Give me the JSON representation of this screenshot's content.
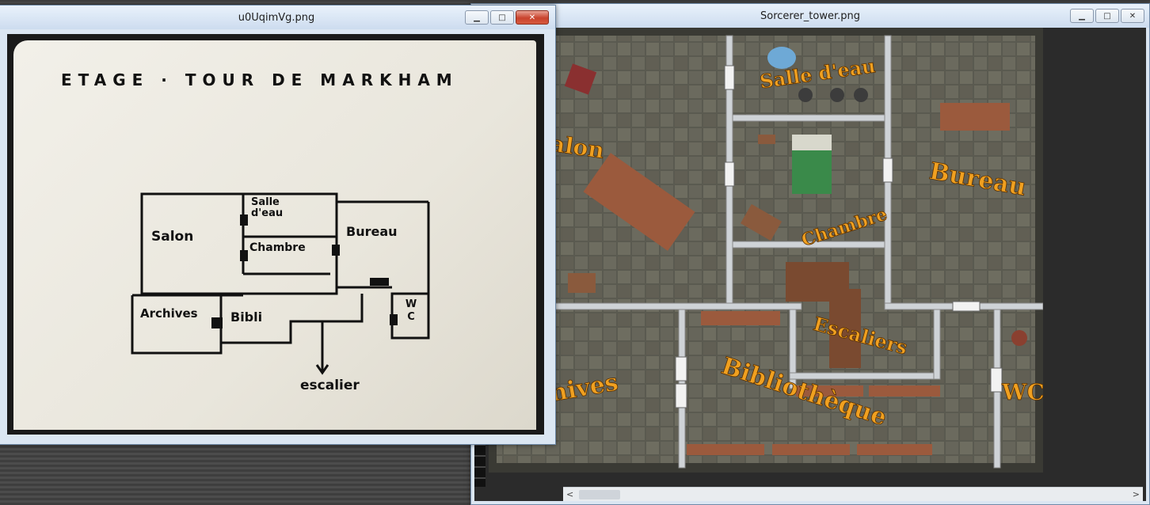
{
  "left_window": {
    "title": "u0UqimVg.png",
    "sketch": {
      "heading": "ETAGE · TOUR DE MARKHAM",
      "rooms": [
        "Salon",
        "Salle d'eau",
        "Chambre",
        "Bureau",
        "Archives",
        "Bibli",
        "W C"
      ],
      "stairs_label": "escalier"
    }
  },
  "right_window": {
    "title": "Sorcerer_tower.png",
    "map_labels": [
      "Salle d'eau",
      "Salon",
      "Bureau",
      "Chambre",
      "Escaliers",
      "Archives",
      "Bibliothèque",
      "WC"
    ]
  },
  "controls": {
    "minimize": "▁",
    "maximize": "□",
    "close": "✕",
    "scroll_left": "<",
    "scroll_right": ">"
  },
  "colors": {
    "map_label": "#f0a020",
    "map_floor": "#4b4b42"
  }
}
